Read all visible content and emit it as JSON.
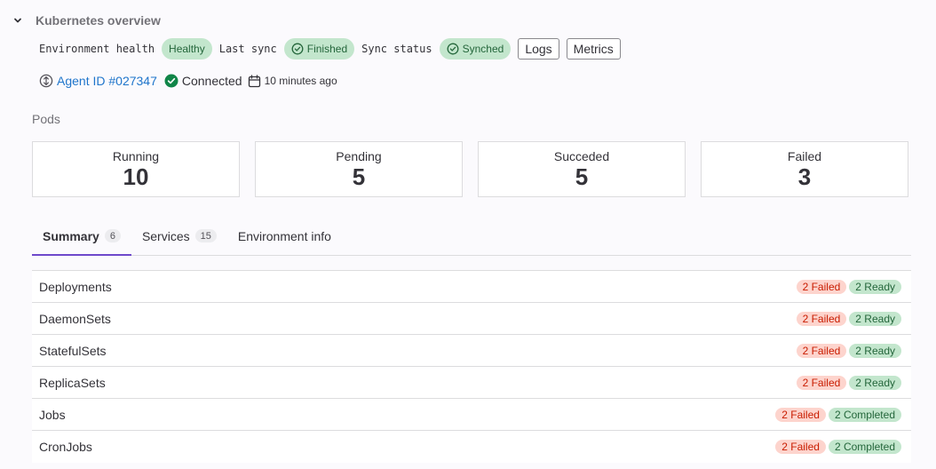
{
  "header": {
    "title": "Kubernetes overview"
  },
  "status": {
    "health_label": "Environment health",
    "health_value": "Healthy",
    "sync_label": "Last sync",
    "sync_value": "Finished",
    "sync_status_label": "Sync status",
    "sync_status_value": "Synched",
    "logs_button": "Logs",
    "metrics_button": "Metrics"
  },
  "agent": {
    "id_link": "Agent ID #027347",
    "connection": "Connected",
    "last_seen": "10 minutes ago"
  },
  "pods": {
    "label": "Pods",
    "cards": [
      {
        "label": "Running",
        "value": "10"
      },
      {
        "label": "Pending",
        "value": "5"
      },
      {
        "label": "Succeded",
        "value": "5"
      },
      {
        "label": "Failed",
        "value": "3"
      }
    ]
  },
  "tabs": [
    {
      "label": "Summary",
      "count": "6"
    },
    {
      "label": "Services",
      "count": "15"
    },
    {
      "label": "Environment info"
    }
  ],
  "workloads": [
    {
      "name": "Deployments",
      "failed": "2 Failed",
      "ok": "2 Ready"
    },
    {
      "name": "DaemonSets",
      "failed": "2 Failed",
      "ok": "2 Ready"
    },
    {
      "name": "StatefulSets",
      "failed": "2 Failed",
      "ok": "2 Ready"
    },
    {
      "name": "ReplicaSets",
      "failed": "2 Failed",
      "ok": "2 Ready"
    },
    {
      "name": "Jobs",
      "failed": "2 Failed",
      "ok": "2 Completed"
    },
    {
      "name": "CronJobs",
      "failed": "2 Failed",
      "ok": "2 Completed"
    }
  ],
  "colors": {
    "accent": "#6e49cb",
    "link": "#1f75cb",
    "success_bg": "#c3e6cd",
    "success_text": "#24663b",
    "danger_bg": "#fdd4cd",
    "danger_text": "#c91c00"
  },
  "icons": {
    "collapse": "chevron-down-icon",
    "check": "check-circle-icon",
    "agent": "agent-icon",
    "connected": "check-circle-filled-icon",
    "calendar": "calendar-icon"
  }
}
